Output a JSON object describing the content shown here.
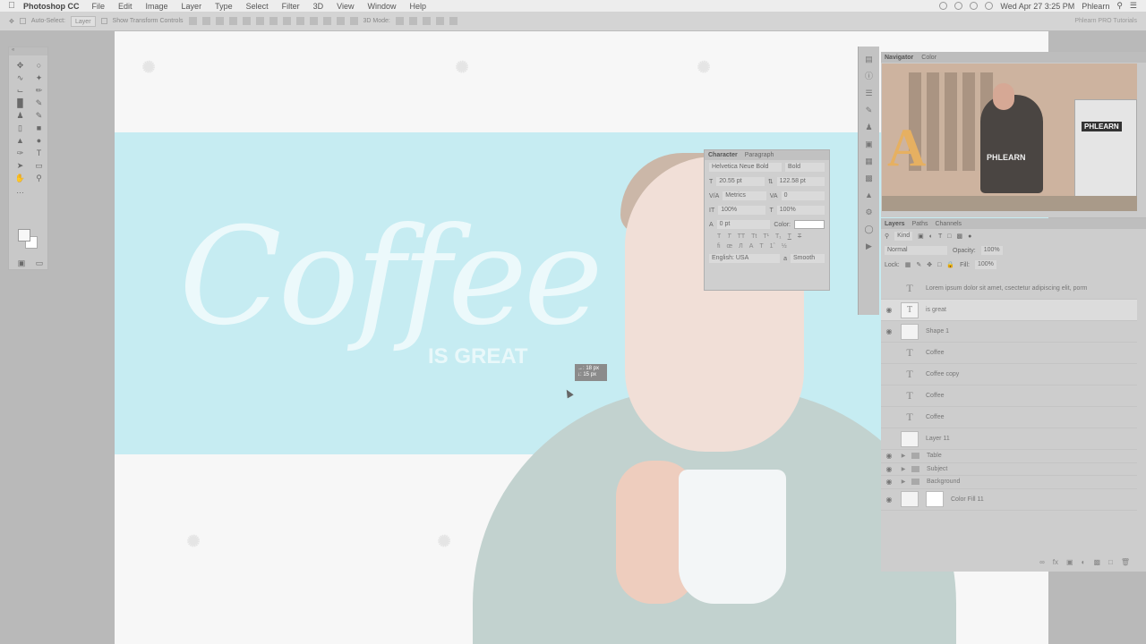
{
  "menubar": {
    "apple": "",
    "app_name": "Photoshop CC",
    "menus": [
      "File",
      "Edit",
      "Image",
      "Layer",
      "Type",
      "Select",
      "Filter",
      "3D",
      "View",
      "Window",
      "Help"
    ],
    "datetime": "Wed Apr 27  3:25 PM",
    "user": "Phlearn"
  },
  "optionsbar": {
    "auto_select_label": "Auto-Select:",
    "auto_select_value": "Layer",
    "show_transform_label": "Show Transform Controls",
    "mode_3d_label": "3D Mode:",
    "workspace": "Phlearn PRO Tutorials"
  },
  "canvas": {
    "headline": "Coffee",
    "subline": "IS GREAT",
    "move_tooltip_x": "→: 18 px",
    "move_tooltip_y": "↓: 15 px"
  },
  "character_panel": {
    "tab_character": "Character",
    "tab_paragraph": "Paragraph",
    "font_family": "Helvetica Neue Bold",
    "font_style": "Bold",
    "font_size": "20.55 pt",
    "leading": "122.58 pt",
    "kerning": "Metrics",
    "tracking": "0",
    "vertical_scale": "100%",
    "horizontal_scale": "100%",
    "baseline_shift": "0 pt",
    "color_label": "Color:",
    "language": "English: USA",
    "aa_label": "a",
    "antialias": "Smooth"
  },
  "navigator": {
    "tab_navigator": "Navigator",
    "tab_color": "Color",
    "shirt_text": "PHLEARN",
    "monitor_text": "PHLEARN",
    "sign_letter": "A"
  },
  "layers_panel": {
    "tab_layers": "Layers",
    "tab_paths": "Paths",
    "tab_channels": "Channels",
    "filter_kind": "Kind",
    "blend_mode": "Normal",
    "opacity_label": "Opacity:",
    "opacity_value": "100%",
    "lock_label": "Lock:",
    "fill_label": "Fill:",
    "fill_value": "100%",
    "layers": [
      {
        "name": "Lorem ipsum dolor sit amet, csectetur adipiscing elit, porm",
        "type": "text",
        "visible": false
      },
      {
        "name": "is great",
        "type": "text",
        "visible": true,
        "selected": true
      },
      {
        "name": "Shape 1",
        "type": "shape",
        "visible": true
      },
      {
        "name": "Coffee",
        "type": "text",
        "visible": false
      },
      {
        "name": "Coffee copy",
        "type": "text",
        "visible": false
      },
      {
        "name": "Coffee",
        "type": "text",
        "visible": false
      },
      {
        "name": "Coffee",
        "type": "text",
        "visible": false
      },
      {
        "name": "Layer 11",
        "type": "pixel",
        "visible": false
      }
    ],
    "groups": [
      "Table",
      "Subject",
      "Background"
    ],
    "fill_layer": "Color Fill 11"
  },
  "colors": {
    "banner": "#c6ecf2",
    "canvas_bg": "#f7f7f7",
    "panel_bg": "#cdcdcd"
  }
}
